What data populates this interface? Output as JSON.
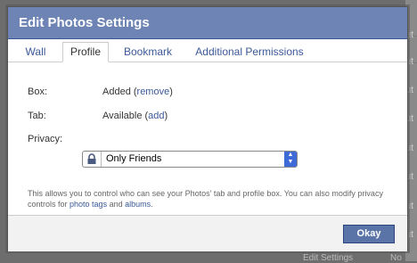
{
  "dialog": {
    "title": "Edit Photos Settings",
    "tabs": [
      {
        "label": "Wall"
      },
      {
        "label": "Profile"
      },
      {
        "label": "Bookmark"
      },
      {
        "label": "Additional Permissions"
      }
    ],
    "active_tab": "Profile",
    "fields": {
      "box_label": "Box:",
      "box_status": "Added (",
      "box_action": "remove",
      "box_close": ")",
      "tab_label": "Tab:",
      "tab_status": "Available (",
      "tab_action": "add",
      "tab_close": ")",
      "privacy_label": "Privacy:",
      "privacy_value": "Only Friends"
    },
    "description": {
      "text1": "This allows you to control who can see your Photos' tab and profile box. You can also modify privacy controls for ",
      "link1": "photo tags",
      "text2": " and ",
      "link2": "albums",
      "text3": "."
    },
    "okay_label": "Okay"
  },
  "background": {
    "fragments": [
      "ut",
      "ut",
      "ut",
      "ut",
      "ut",
      "ut",
      "ut",
      "ut"
    ],
    "bottom_text": "Edit Settings",
    "bottom_text2": "No"
  },
  "colors": {
    "titlebar": "#6d84b4",
    "link": "#3b5998",
    "button": "#5b74a8"
  }
}
